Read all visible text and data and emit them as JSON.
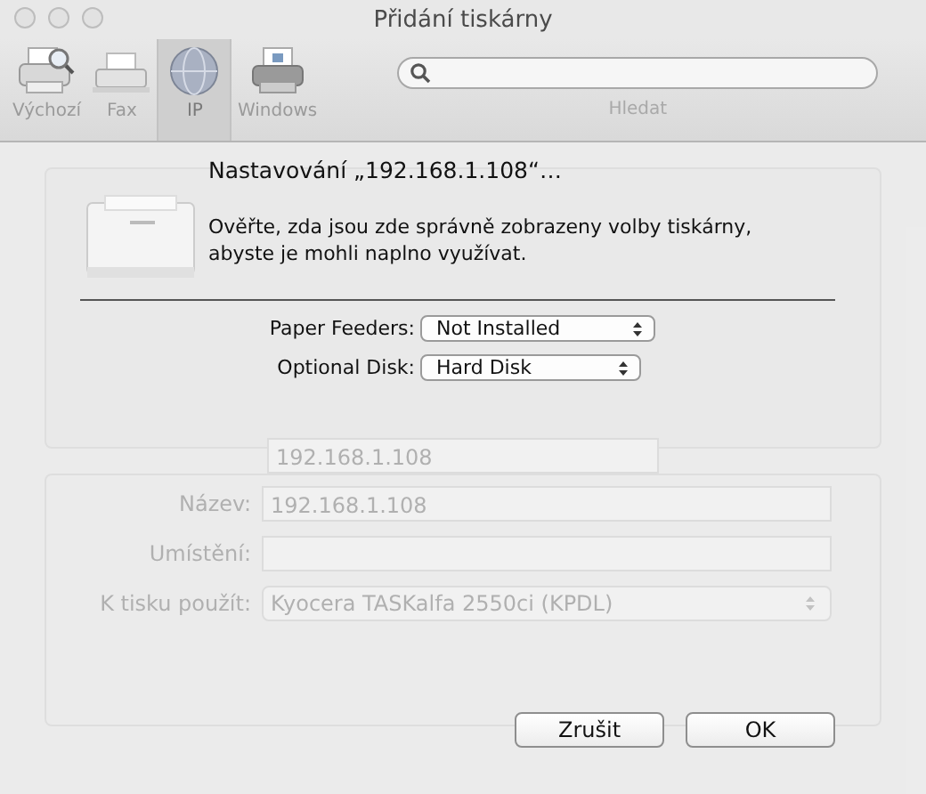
{
  "window": {
    "title": "Přidání tiskárny"
  },
  "toolbar": {
    "items": [
      {
        "label": "Výchozí",
        "kind": "default",
        "selected": false
      },
      {
        "label": "Fax",
        "kind": "fax",
        "selected": false
      },
      {
        "label": "IP",
        "kind": "ip",
        "selected": true
      },
      {
        "label": "Windows",
        "kind": "windows",
        "selected": false
      }
    ],
    "search": {
      "label": "Hledat"
    }
  },
  "background_form": {
    "address": "192.168.1.108",
    "fields": [
      {
        "label": "Název:",
        "kind": "text",
        "value": "192.168.1.108"
      },
      {
        "label": "Umístění:",
        "kind": "text"
      },
      {
        "label": "K tisku použít:",
        "kind": "popup",
        "value": "Kyocera TASKalfa 2550ci (KPDL)"
      }
    ]
  },
  "sheet": {
    "title": "Nastavování „192.168.1.108“…",
    "message": "Ověřte, zda jsou zde správně zobrazeny volby tiskárny, abyste je mohli naplno využívat.",
    "options": [
      {
        "label": "Paper Feeders:",
        "value": "Not Installed"
      },
      {
        "label": "Optional Disk:",
        "value": "Hard Disk"
      }
    ],
    "buttons": [
      "Zrušit",
      "OK"
    ]
  }
}
